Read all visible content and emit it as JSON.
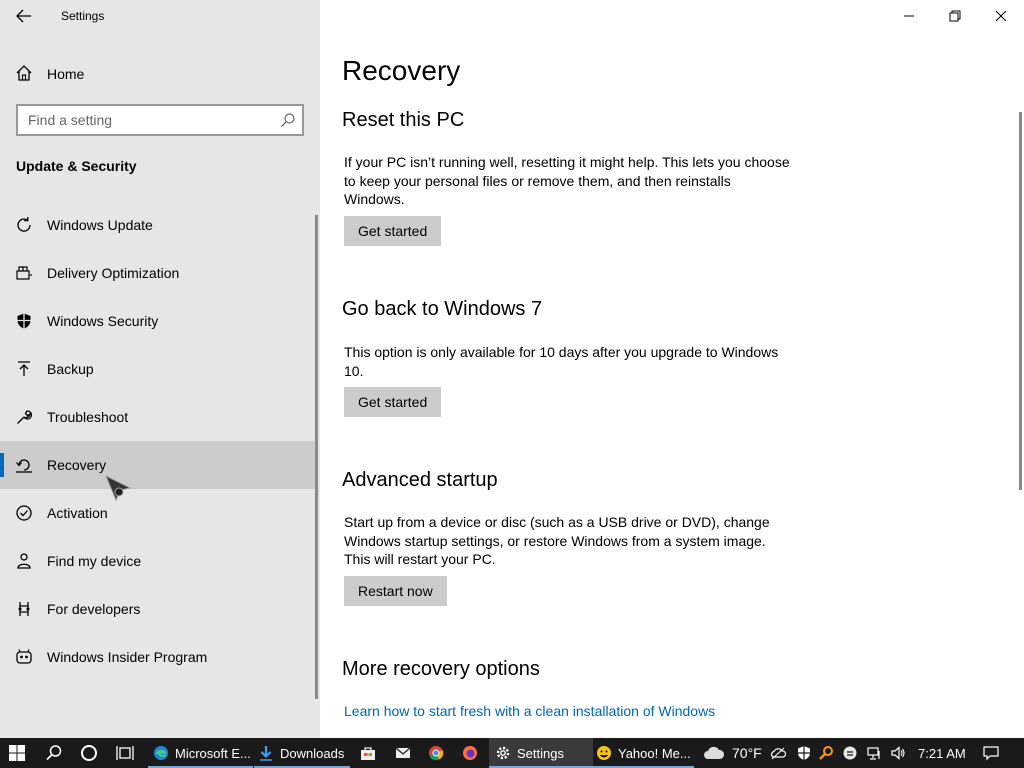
{
  "window": {
    "title": "Settings"
  },
  "sidebar": {
    "home_label": "Home",
    "search_placeholder": "Find a setting",
    "section_title": "Update & Security",
    "items": [
      {
        "label": "Windows Update",
        "icon": "refresh-icon"
      },
      {
        "label": "Delivery Optimization",
        "icon": "delivery-icon"
      },
      {
        "label": "Windows Security",
        "icon": "shield-icon"
      },
      {
        "label": "Backup",
        "icon": "backup-icon"
      },
      {
        "label": "Troubleshoot",
        "icon": "wrench-icon"
      },
      {
        "label": "Recovery",
        "icon": "recovery-icon",
        "selected": true
      },
      {
        "label": "Activation",
        "icon": "check-circle-icon"
      },
      {
        "label": "Find my device",
        "icon": "person-pin-icon"
      },
      {
        "label": "For developers",
        "icon": "developer-icon"
      },
      {
        "label": "Windows Insider Program",
        "icon": "insider-icon"
      }
    ]
  },
  "main": {
    "title": "Recovery",
    "reset": {
      "heading": "Reset this PC",
      "text": "If your PC isn’t running well, resetting it might help. This lets you choose to keep your personal files or remove them, and then reinstalls Windows.",
      "button": "Get started"
    },
    "go_back": {
      "heading": "Go back to Windows 7",
      "text": "This option is only available for 10 days after you upgrade to Windows 10.",
      "button": "Get started"
    },
    "advanced": {
      "heading": "Advanced startup",
      "text": "Start up from a device or disc (such as a USB drive or DVD), change Windows startup settings, or restore Windows from a system image. This will restart your PC.",
      "button": "Restart now"
    },
    "more": {
      "heading": "More recovery options",
      "link": "Learn how to start fresh with a clean installation of Windows"
    }
  },
  "taskbar": {
    "apps": [
      {
        "label": "Microsoft E...",
        "icon": "edge-icon"
      },
      {
        "label": "Downloads",
        "icon": "download-folder-icon"
      },
      {
        "label": "Settings",
        "icon": "gear-icon",
        "active": true
      },
      {
        "label": "Yahoo! Me...",
        "icon": "yahoo-messenger-icon"
      }
    ],
    "weather": "70°F",
    "time": "7:21 AM"
  },
  "colors": {
    "accent": "#0067c0",
    "link": "#0066b4",
    "sidebar_bg": "#e6e6e6",
    "taskbar_bg": "#1a1a1a"
  }
}
